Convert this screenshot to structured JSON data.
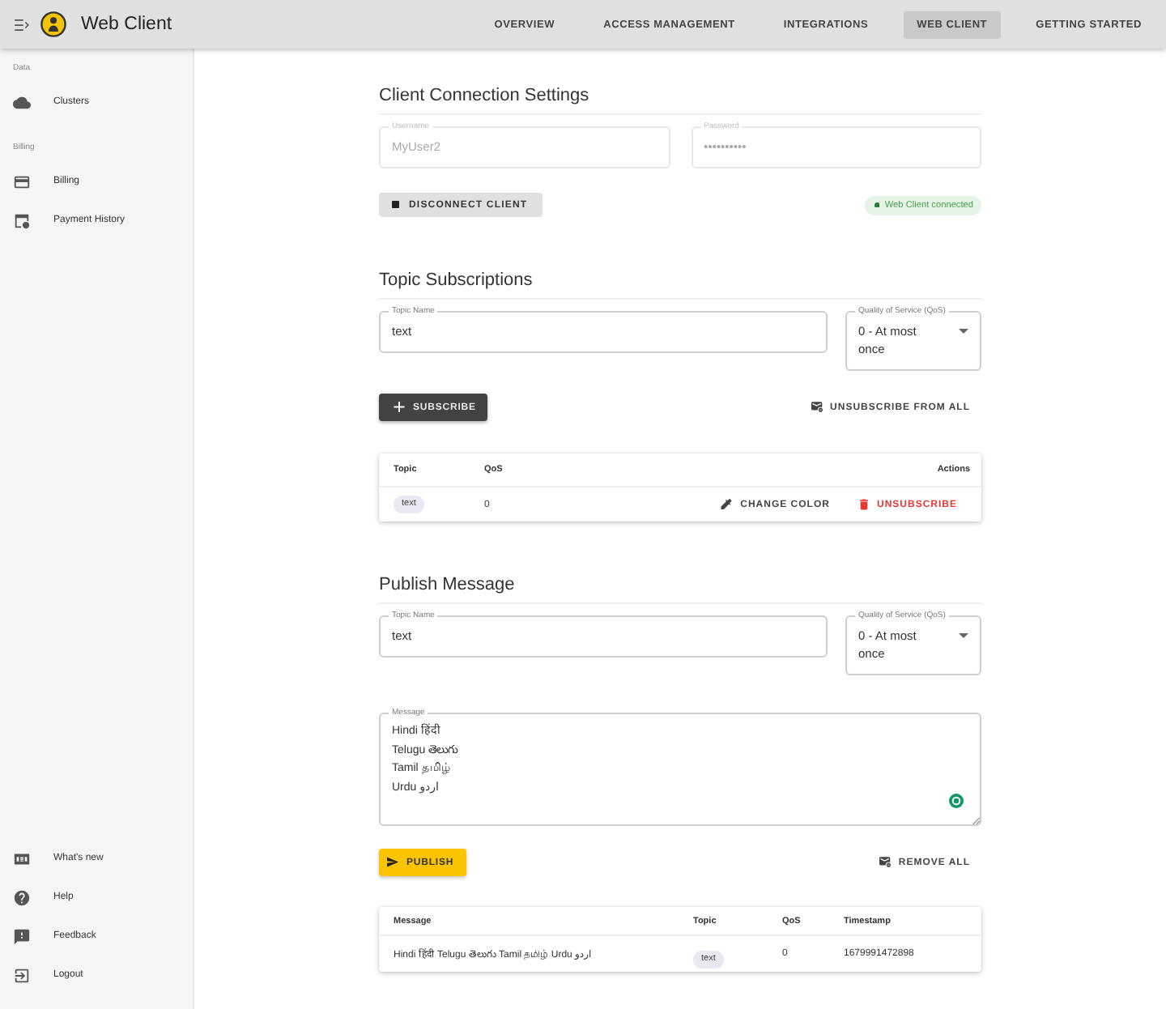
{
  "app_bar": {
    "title": "Web Client",
    "nav": [
      {
        "label": "OVERVIEW",
        "selected": false
      },
      {
        "label": "ACCESS MANAGEMENT",
        "selected": false
      },
      {
        "label": "INTEGRATIONS",
        "selected": false
      },
      {
        "label": "WEB CLIENT",
        "selected": true
      },
      {
        "label": "GETTING STARTED",
        "selected": false
      }
    ]
  },
  "sidebar": {
    "sections": [
      {
        "heading": "Data",
        "items": [
          {
            "label": "Clusters",
            "kind": "clusters",
            "selected": false
          }
        ]
      },
      {
        "heading": "Billing",
        "items": [
          {
            "label": "Billing",
            "kind": "billing",
            "selected": false
          },
          {
            "label": "Payment History",
            "kind": "payment_history",
            "selected": false
          }
        ]
      }
    ],
    "footer_items": [
      {
        "label": "What's new",
        "kind": "whats_new",
        "selected": false
      },
      {
        "label": "Help",
        "kind": "help",
        "selected": false
      },
      {
        "label": "Feedback",
        "kind": "feedback",
        "selected": false
      },
      {
        "label": "Logout",
        "kind": "logout",
        "selected": false
      }
    ]
  },
  "connection": {
    "heading": "Client Connection Settings",
    "username": {
      "label": "Username",
      "value": "MyUser2",
      "disabled": true
    },
    "password": {
      "label": "Password",
      "value": "••••••••••",
      "disabled": true
    },
    "disconnect_button": "DISCONNECT CLIENT",
    "status": {
      "text": "Web Client connected",
      "connected": true
    }
  },
  "subscriptions": {
    "heading": "Topic Subscriptions",
    "topic_field": {
      "label": "Topic Name",
      "value": "text"
    },
    "qos_select": {
      "label": "Quality of Service (QoS)",
      "value": "0 - At most once"
    },
    "subscribe_button": "SUBSCRIBE",
    "unsubscribe_all_button": "UNSUBSCRIBE FROM ALL",
    "table": {
      "columns": [
        "Topic",
        "QoS",
        "Actions"
      ],
      "rows": [
        {
          "topic": "text",
          "qos": "0",
          "change_color_button": "CHANGE COLOR",
          "unsubscribe_button": "UNSUBSCRIBE"
        }
      ]
    }
  },
  "publish": {
    "heading": "Publish Message",
    "topic_field": {
      "label": "Topic Name",
      "value": "text"
    },
    "qos_select": {
      "label": "Quality of Service (QoS)",
      "value": "0 - At most once"
    },
    "message_field": {
      "label": "Message",
      "value": "Hindi हिंदी\nTelugu తెలుగు\nTamil தமிழ்\nUrdu اردو"
    },
    "publish_button": "PUBLISH",
    "remove_all_button": "REMOVE ALL",
    "table": {
      "columns": [
        "Message",
        "Topic",
        "QoS",
        "Timestamp"
      ],
      "rows": [
        {
          "message": "Hindi हिंदी Telugu తెలుగు Tamil தமிழ் Urdu اردو",
          "topic": "text",
          "qos": "0",
          "timestamp": "1679991472898"
        }
      ]
    }
  }
}
